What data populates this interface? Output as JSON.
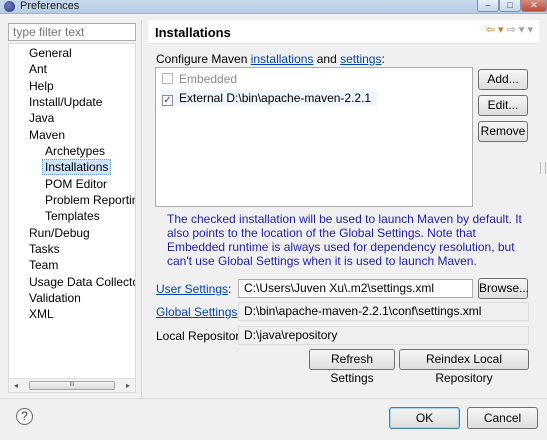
{
  "window": {
    "title": "Preferences",
    "controls": [
      "–",
      "□",
      "✕"
    ]
  },
  "sidebar": {
    "filter_placeholder": "type filter text",
    "items": [
      {
        "label": "General",
        "level": 1
      },
      {
        "label": "Ant",
        "level": 1
      },
      {
        "label": "Help",
        "level": 1
      },
      {
        "label": "Install/Update",
        "level": 1
      },
      {
        "label": "Java",
        "level": 1
      },
      {
        "label": "Maven",
        "level": 1
      },
      {
        "label": "Archetypes",
        "level": 2
      },
      {
        "label": "Installations",
        "level": 2,
        "selected": true
      },
      {
        "label": "POM Editor",
        "level": 2
      },
      {
        "label": "Problem Reporting",
        "level": 2
      },
      {
        "label": "Templates",
        "level": 2
      },
      {
        "label": "Run/Debug",
        "level": 1
      },
      {
        "label": "Tasks",
        "level": 1
      },
      {
        "label": "Team",
        "level": 1
      },
      {
        "label": "Usage Data Collector",
        "level": 1
      },
      {
        "label": "Validation",
        "level": 1
      },
      {
        "label": "XML",
        "level": 1
      }
    ],
    "scroll_left": "◂",
    "scroll_right": "▸",
    "scroll_grip": "III"
  },
  "page": {
    "title": "Installations",
    "nav_back": "⇦ ▾",
    "nav_forward": "⇨ ▾",
    "configure_prefix": "Configure Maven ",
    "configure_link1": "installations",
    "configure_mid": " and ",
    "configure_link2": "settings",
    "configure_suffix": ":",
    "installations": [
      {
        "label": "Embedded",
        "checked": false,
        "disabled": true
      },
      {
        "label": "External D:\\bin\\apache-maven-2.2.1",
        "checked": true,
        "disabled": false
      }
    ],
    "check_mark": "✓",
    "buttons": {
      "add": "Add...",
      "edit": "Edit...",
      "remove": "Remove",
      "browse": "Browse...",
      "refresh": "Refresh Settings",
      "reindex": "Reindex Local Repository"
    },
    "info_text": "The checked installation will be used to launch Maven by default. It also points to the location of the Global Settings. Note that Embedded runtime is always used for dependency resolution, but can't use Global Settings when it is used to launch Maven.",
    "user_settings_label": "User Settings",
    "user_settings_value": "C:\\Users\\Juven Xu\\.m2\\settings.xml",
    "global_settings_label": "Global Settings",
    "global_settings_value": "D:\\bin\\apache-maven-2.2.1\\conf\\settings.xml",
    "local_repo_label": "Local Repository:",
    "local_repo_value": "D:\\java\\repository",
    "colon": ":"
  },
  "footer": {
    "help": "?",
    "ok": "OK",
    "cancel": "Cancel"
  }
}
